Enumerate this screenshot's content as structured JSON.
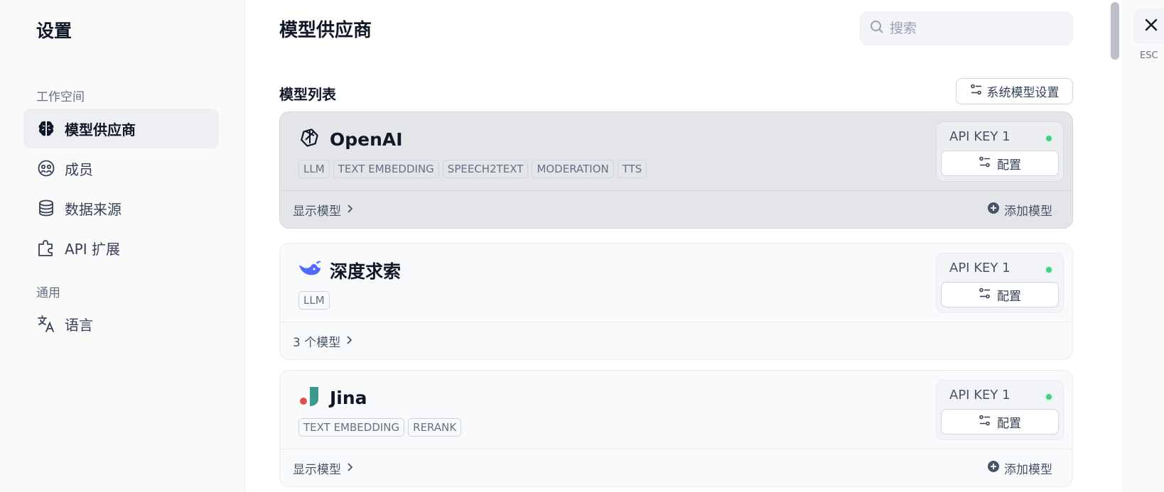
{
  "sidebar": {
    "title": "设置",
    "groups": [
      {
        "label": "工作空间",
        "items": [
          {
            "label": "模型供应商",
            "icon": "brain-icon",
            "active": true
          },
          {
            "label": "成员",
            "icon": "members-icon",
            "active": false
          },
          {
            "label": "数据来源",
            "icon": "database-icon",
            "active": false
          },
          {
            "label": "API 扩展",
            "icon": "puzzle-icon",
            "active": false
          }
        ]
      },
      {
        "label": "通用",
        "items": [
          {
            "label": "语言",
            "icon": "translate-icon",
            "active": false
          }
        ]
      }
    ]
  },
  "main": {
    "title": "模型供应商",
    "search": {
      "placeholder": "搜索",
      "value": ""
    },
    "section_title": "模型列表",
    "system_model_button": "系统模型设置",
    "providers": [
      {
        "name": "OpenAI",
        "logo": "openai-logo-icon",
        "tags": [
          "LLM",
          "TEXT EMBEDDING",
          "SPEECH2TEXT",
          "MODERATION",
          "TTS"
        ],
        "api_key_label": "API KEY 1",
        "config_label": "配置",
        "footer_left": "显示模型",
        "footer_right": "添加模型"
      },
      {
        "name": "深度求索",
        "logo": "deepseek-whale-icon",
        "tags": [
          "LLM"
        ],
        "api_key_label": "API KEY 1",
        "config_label": "配置",
        "footer_left": "3 个模型",
        "footer_right": ""
      },
      {
        "name": "Jina",
        "logo": "jina-logo-icon",
        "tags": [
          "TEXT EMBEDDING",
          "RERANK"
        ],
        "api_key_label": "API KEY 1",
        "config_label": "配置",
        "footer_left": "显示模型",
        "footer_right": "添加模型"
      }
    ]
  },
  "close": {
    "esc_label": "ESC"
  },
  "colors": {
    "status_ok": "#47cd89",
    "deepseek_blue": "#4d6bfe",
    "jina_red": "#e14f4f",
    "jina_teal": "#3a9a8c"
  }
}
